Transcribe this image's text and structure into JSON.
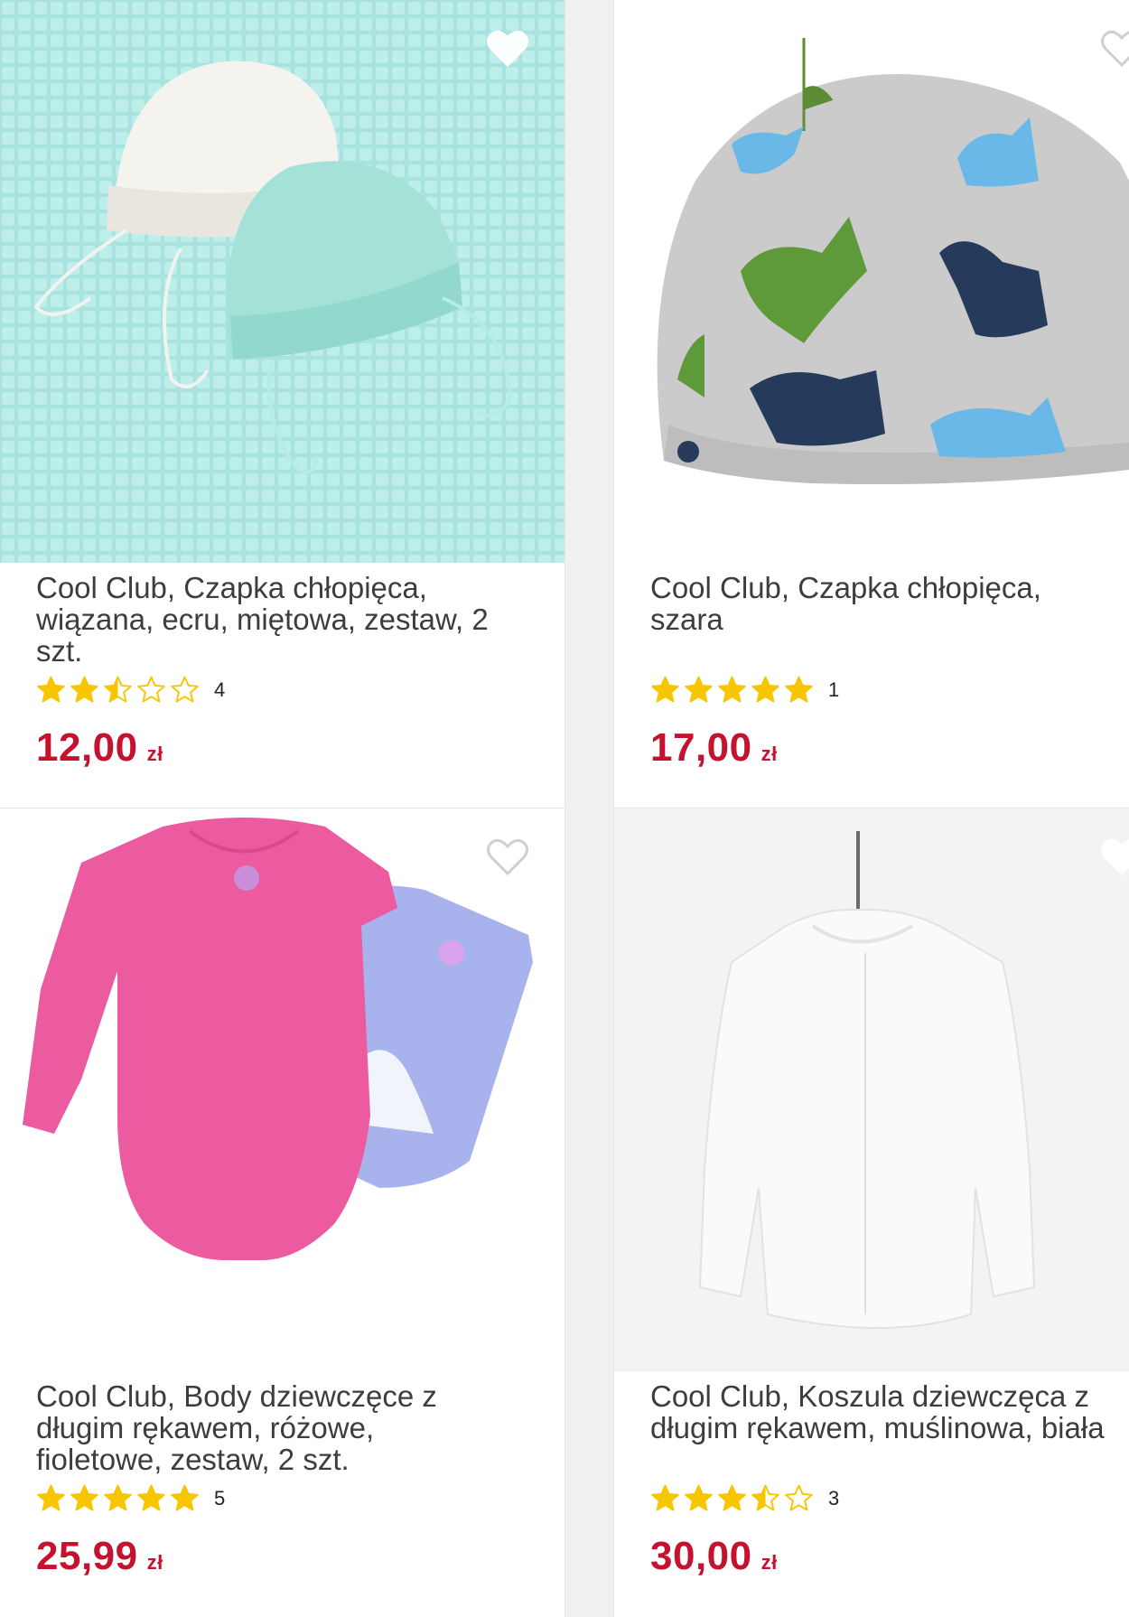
{
  "colors": {
    "price": "#c4122f",
    "star": "#f7c600",
    "star_outline": "#f7c600",
    "background": "#f0f0f0"
  },
  "products": [
    {
      "title": "Cool Club, Czapka chłopięca,\nwiązana, ecru, miętowa, zestaw, 2\nszt.",
      "rating": 2.5,
      "review_count": "4",
      "price": "12,00",
      "currency": "zł",
      "favorite_icon": "heart-outline-icon"
    },
    {
      "title": "Cool Club, Czapka chłopięca, szara",
      "rating": 5,
      "review_count": "1",
      "price": "17,00",
      "currency": "zł",
      "favorite_icon": "heart-outline-icon"
    },
    {
      "title": "Cool Club, Body dziewczęce z\ndługim rękawem, różowe,\nfioletowe, zestaw, 2 szt.",
      "rating": 5,
      "review_count": "5",
      "price": "25,99",
      "currency": "zł",
      "favorite_icon": "heart-outline-icon"
    },
    {
      "title": "Cool Club, Koszula dziewczęca z\ndługim rękawem, muślinowa, biała",
      "rating": 3.5,
      "review_count": "3",
      "price": "30,00",
      "currency": "zł",
      "favorite_icon": "heart-outline-icon"
    }
  ]
}
